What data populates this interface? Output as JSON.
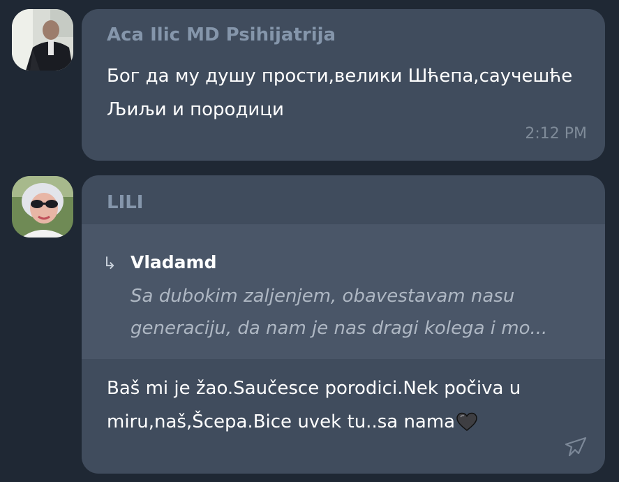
{
  "messages": [
    {
      "sender": "Aca Ilic MD Psihijatrija",
      "text": "Бог да му душу прости,велики Шћепа,саучешће Љиљи и породици",
      "time": "2:12 PM",
      "avatar_icon": "user-photo-avatar"
    },
    {
      "sender": "LILI",
      "quote": {
        "arrow": "↳",
        "author": "Vladamd",
        "text": "Sa dubokim zaljenjem, obavestavam nasu generaciju,  da nam je nas dragi kolega i mo..."
      },
      "text": "Baš mi je žao.Saučesce porodici.Nek počiva u miru,naš,Šcepa.Bice uvek tu..sa nama",
      "emoji_icon": "black-heart-icon",
      "reply_icon": "reply-arrow-icon",
      "avatar_icon": "user-photo-avatar"
    }
  ],
  "colors": {
    "background": "#1f2834",
    "bubble": "#404c5d",
    "quote_bg": "#4a5668",
    "sender_name": "#8596ab",
    "time": "#7f8b99"
  }
}
